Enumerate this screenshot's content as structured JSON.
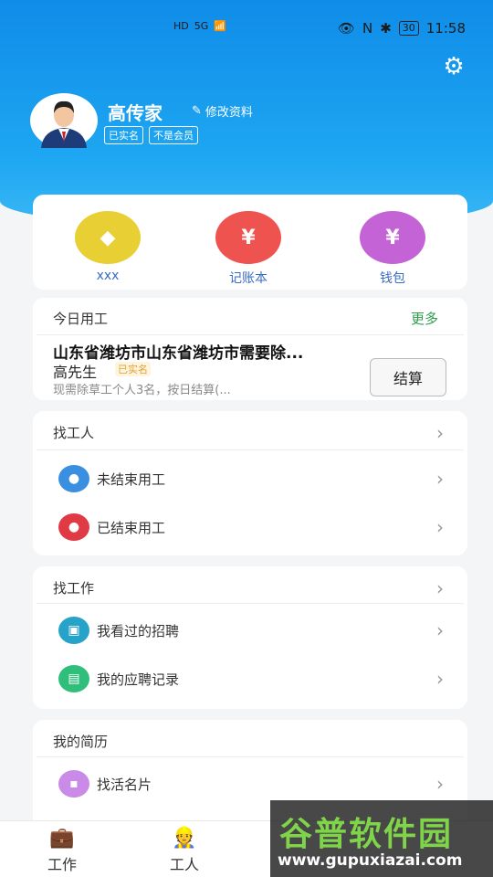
{
  "status_bar": {
    "network_labels": [
      "HD",
      "5G",
      "wifi",
      "app",
      "V"
    ],
    "battery": "30",
    "time": "11:58"
  },
  "profile": {
    "name": "高传家",
    "edit_label": "修改资料",
    "badges": [
      "已实名",
      "不是会员"
    ]
  },
  "quick_actions": [
    {
      "label": "xxx",
      "icon": "diamond-icon",
      "color": "#e8cf33",
      "glyph": "◆"
    },
    {
      "label": "记账本",
      "icon": "ledger-icon",
      "color": "#ef5350",
      "glyph": "¥"
    },
    {
      "label": "钱包",
      "icon": "money-bag-icon",
      "color": "#c463d6",
      "glyph": "¥"
    }
  ],
  "today_work": {
    "title": "今日用工",
    "more": "更多",
    "job_title": "山东省潍坊市山东省潍坊市需要除...",
    "employer": "高先生",
    "verified": "已实名",
    "description": "现需除草工个人3名，按日结算(...",
    "settle_label": "结算"
  },
  "find_worker": {
    "title": "找工人",
    "items": [
      {
        "label": "未结束用工",
        "icon": "ongoing-user-icon",
        "color": "#3a8fe0"
      },
      {
        "label": "已结束用工",
        "icon": "ended-user-icon",
        "color": "#e03a45"
      }
    ]
  },
  "find_job": {
    "title": "找工作",
    "items": [
      {
        "label": "我看过的招聘",
        "icon": "briefcase-icon",
        "color": "#27a3c9"
      },
      {
        "label": "我的应聘记录",
        "icon": "document-icon",
        "color": "#2fbf7a"
      }
    ]
  },
  "resume": {
    "title": "我的简历",
    "items": [
      {
        "label": "找活名片",
        "icon": "card-icon",
        "color": "#c98ae8"
      }
    ]
  },
  "tabs": [
    {
      "label": "工作",
      "icon": "briefcase-icon"
    },
    {
      "label": "工人",
      "icon": "worker-icon"
    }
  ],
  "watermark": {
    "title": "谷普软件园",
    "url": "www.gupuxiazai.com"
  }
}
